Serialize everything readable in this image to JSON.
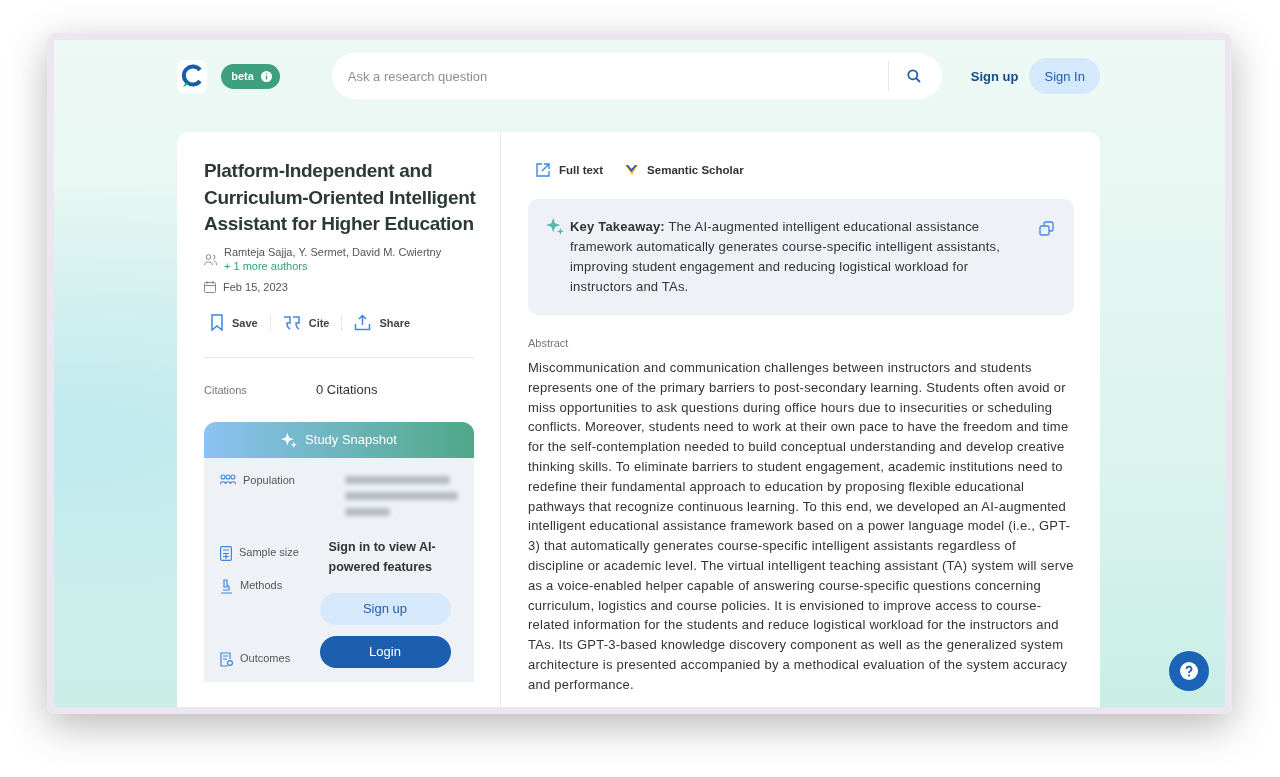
{
  "header": {
    "badge": "beta",
    "search": {
      "placeholder": "Ask a research question"
    },
    "sign_up": "Sign up",
    "sign_in": "Sign In"
  },
  "paper": {
    "title": "Platform-Independent and Curriculum-Oriented Intelligent Assistant for Higher Education",
    "authors": "Ramteja Sajja, Y. Sermet, David M. Cwiertny",
    "more_authors": "+ 1 more authors",
    "date": "Feb 15, 2023",
    "actions": [
      {
        "kind": "save",
        "label": "Save"
      },
      {
        "kind": "cite",
        "label": "Cite"
      },
      {
        "kind": "share",
        "label": "Share"
      }
    ],
    "citations": {
      "label": "Citations",
      "value": "0 Citations"
    }
  },
  "snapshot": {
    "title": "Study Snapshot",
    "rows": [
      {
        "kind": "population",
        "label": "Population"
      },
      {
        "kind": "sample_size",
        "label": "Sample size"
      },
      {
        "kind": "methods",
        "label": "Methods"
      },
      {
        "kind": "outcomes",
        "label": "Outcomes"
      }
    ],
    "prompt": "Sign in to view AI-powered features",
    "buttons": [
      {
        "kind": "secondary",
        "label": "Sign up"
      },
      {
        "kind": "primary",
        "label": "Login"
      }
    ]
  },
  "links": [
    {
      "kind": "full_text",
      "label": "Full text"
    },
    {
      "kind": "semantic_scholar",
      "label": "Semantic Scholar"
    }
  ],
  "key_takeaway": "**Key Takeaway:** The AI-augmented intelligent educational assistance framework automatically generates course-specific intelligent assistants, improving student engagement and reducing logistical workload for instructors and TAs.",
  "abstract": {
    "label": "Abstract",
    "text": "Miscommunication and communication challenges between instructors and students represents one of the primary barriers to post-secondary learning. Students often avoid or miss opportunities to ask questions during office hours due to insecurities or scheduling conflicts. Moreover, students need to work at their own pace to have the freedom and time for the self-contemplation needed to build conceptual understanding and develop creative thinking skills. To eliminate barriers to student engagement, academic institutions need to redefine their fundamental approach to education by proposing flexible educational pathways that recognize continuous learning. To this end, we developed an AI-augmented intelligent educational assistance framework based on a power language model (i.e., GPT-3) that automatically generates course-specific intelligent assistants regardless of discipline or academic level. The virtual intelligent teaching assistant (TA) system will serve as a voice-enabled helper capable of answering course-specific questions concerning curriculum, logistics and course policies. It is envisioned to improve access to course-related information for the students and reduce logistical workload for the instructors and TAs. Its GPT-3-based knowledge discovery component as well as the generalized system architecture is presented accompanied by a methodical evaluation of the system accuracy and performance."
  }
}
